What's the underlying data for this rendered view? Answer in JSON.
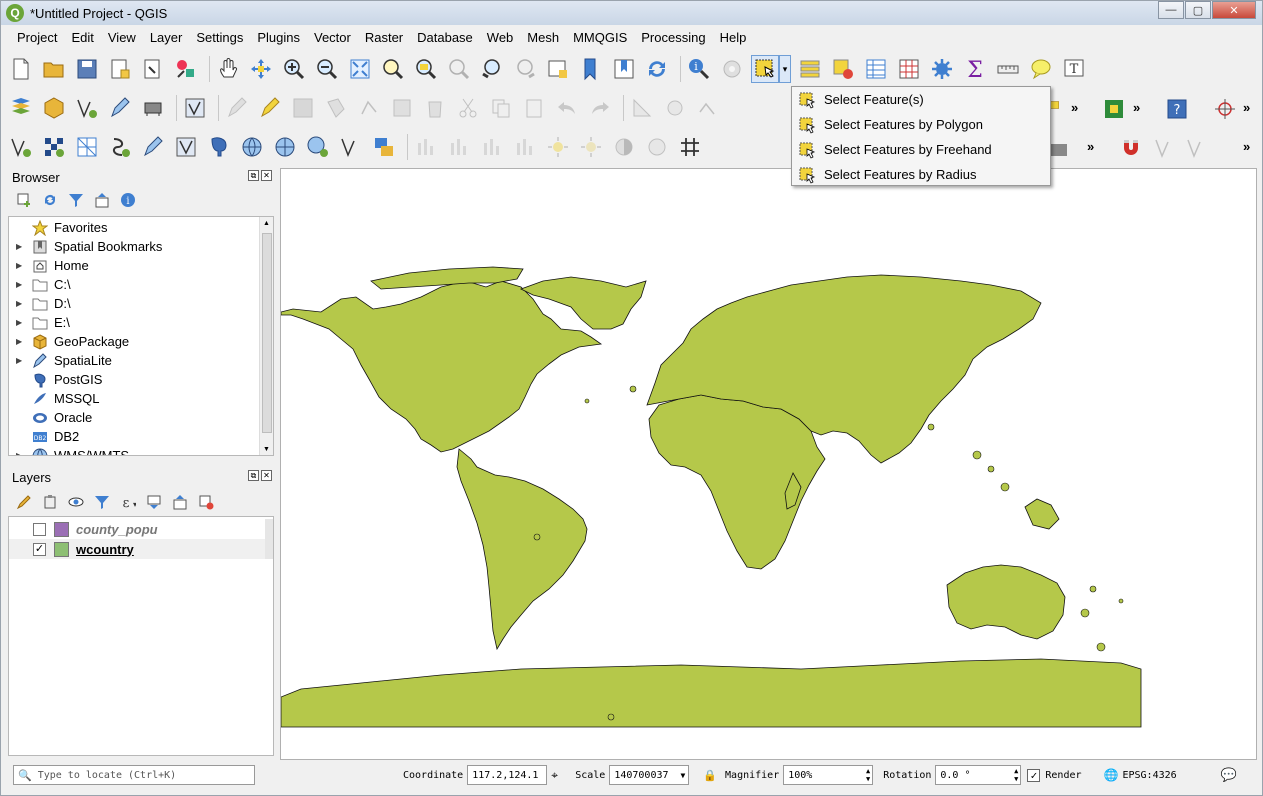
{
  "window": {
    "title": "*Untitled Project - QGIS",
    "logo": "Q",
    "min": "—",
    "max": "▢",
    "close": "✕"
  },
  "menu": [
    "Project",
    "Edit",
    "View",
    "Layer",
    "Settings",
    "Plugins",
    "Vector",
    "Raster",
    "Database",
    "Web",
    "Mesh",
    "MMQGIS",
    "Processing",
    "Help"
  ],
  "browser": {
    "title": "Browser",
    "items": [
      {
        "label": "Favorites",
        "icon": "star-icon",
        "arrow": false
      },
      {
        "label": "Spatial Bookmarks",
        "icon": "bookmark-icon",
        "arrow": true
      },
      {
        "label": "Home",
        "icon": "home-folder-icon",
        "arrow": true
      },
      {
        "label": "C:\\",
        "icon": "folder-icon",
        "arrow": true
      },
      {
        "label": "D:\\",
        "icon": "folder-icon",
        "arrow": true
      },
      {
        "label": "E:\\",
        "icon": "folder-icon",
        "arrow": true
      },
      {
        "label": "GeoPackage",
        "icon": "geopackage-icon",
        "arrow": true
      },
      {
        "label": "SpatiaLite",
        "icon": "spatialite-icon",
        "arrow": true
      },
      {
        "label": "PostGIS",
        "icon": "postgis-icon",
        "arrow": false
      },
      {
        "label": "MSSQL",
        "icon": "mssql-icon",
        "arrow": false
      },
      {
        "label": "Oracle",
        "icon": "oracle-icon",
        "arrow": false
      },
      {
        "label": "DB2",
        "icon": "db2-icon",
        "arrow": false
      },
      {
        "label": "WMS/WMTS",
        "icon": "wms-icon",
        "arrow": true
      }
    ],
    "db2_badge": "DB2"
  },
  "layers": {
    "title": "Layers",
    "items": [
      {
        "name": "county_popu",
        "checked": false,
        "color": "#9b6fb5",
        "style": "italic-disabled"
      },
      {
        "name": "wcountry",
        "checked": true,
        "color": "#8dbf73",
        "style": "bold-underline"
      }
    ]
  },
  "dropdown": {
    "items": [
      "Select Feature(s)",
      "Select Features by Polygon",
      "Select Features by Freehand",
      "Select Features by Radius"
    ]
  },
  "status": {
    "locate_placeholder": "Type to locate (Ctrl+K)",
    "coordinate_label": "Coordinate",
    "coordinate_value": "117.2,124.1",
    "scale_label": "Scale",
    "scale_value": "140700037",
    "magnifier_label": "Magnifier",
    "magnifier_value": "100%",
    "rotation_label": "Rotation",
    "rotation_value": "0.0 °",
    "render_label": "Render",
    "render_checked": true,
    "crs": "EPSG:4326"
  },
  "colors": {
    "land": "#b5c84a",
    "land_stroke": "#111111",
    "accent_green": "#6ba539"
  }
}
